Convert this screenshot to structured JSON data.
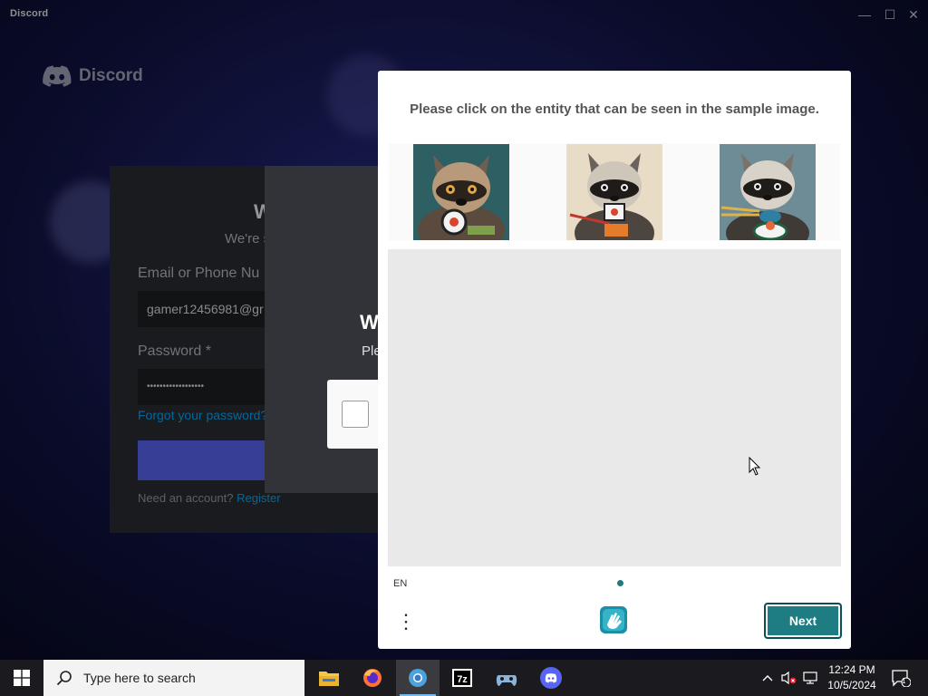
{
  "window": {
    "title": "Discord",
    "minimize": "—",
    "maximize": "☐",
    "close": "✕"
  },
  "brand": {
    "name": "Discord"
  },
  "login": {
    "title": "W",
    "subtitle": "We're s",
    "email_label": "Email or Phone Nu",
    "email_value": "gamer12456981@gr",
    "password_label": "Password *",
    "password_value": "••••••••••••••••••",
    "forgot": "Forgot your password?",
    "need_account": "Need an account?",
    "register": "Register"
  },
  "wait": {
    "title": "W",
    "subtitle": "Ple"
  },
  "captcha": {
    "prompt": "Please click on the entity that can be seen in the sample image.",
    "samples": [
      "raccoon-eating-sushi-1",
      "raccoon-eating-sushi-2",
      "raccoon-eating-sushi-3"
    ],
    "language": "EN",
    "next_label": "Next",
    "accent_color": "#1d7d82"
  },
  "taskbar": {
    "search_placeholder": "Type here to search",
    "apps": [
      "file-explorer-icon",
      "firefox-icon",
      "chrome-icon",
      "7zip-icon",
      "steam-icon",
      "discord-icon"
    ],
    "time": "12:24 PM",
    "date": "10/5/2024",
    "notifications": "1"
  }
}
